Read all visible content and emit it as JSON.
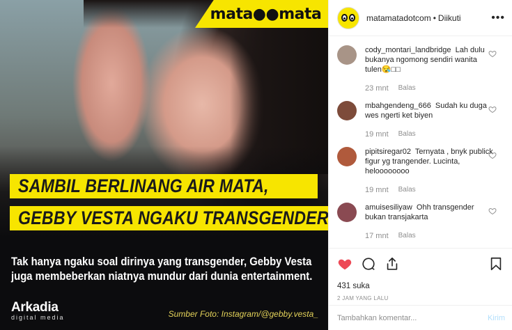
{
  "post_image": {
    "brand": "mata●●mata",
    "headline_line1": "SAMBIL BERLINANG AIR MATA,",
    "headline_line2": "GEBBY VESTA NGAKU TRANSGENDER",
    "subcaption": "Tak hanya ngaku soal dirinya yang transgender, Gebby Vesta juga membeberkan niatnya mundur dari dunia entertainment.",
    "publisher_logo": "Arkadia",
    "publisher_tagline": "digital media",
    "photo_credit": "Sumber Foto: Instagram/@gebby.vesta_"
  },
  "header": {
    "username": "matamatadotcom",
    "separator": "•",
    "follow_status": "Diikuti",
    "more_icon": "more-horizontal-icon"
  },
  "comments": [
    {
      "username": "cody_montari_landbridge",
      "text": "Lah dulu bukanya ngomong sendiri wanita tulen😪□□",
      "time": "23 mnt",
      "reply_label": "Balas",
      "avatar_color": "#a89487"
    },
    {
      "username": "mbahgendeng_666",
      "text": "Sudah ku duga wes ngerti ket biyen",
      "time": "19 mnt",
      "reply_label": "Balas",
      "avatar_color": "#7d4b3a"
    },
    {
      "username": "pipitsiregar02",
      "text": "Ternyata , bnyk publick figur yg trangender. Lucinta, heloooooooo",
      "time": "19 mnt",
      "reply_label": "Balas",
      "avatar_color": "#b05a3c"
    },
    {
      "username": "amuisesiliyaw",
      "text": "Ohh transgender bukan transjakarta",
      "time": "17 mnt",
      "reply_label": "Balas",
      "avatar_color": "#8a4a52"
    }
  ],
  "actions": {
    "like_icon": "heart-filled-icon",
    "comment_icon": "comment-bubble-icon",
    "share_icon": "share-icon",
    "save_icon": "bookmark-icon",
    "like_color": "#ed4956"
  },
  "likes_text": "431 suka",
  "time_ago": "2 JAM YANG LALU",
  "add_comment": {
    "placeholder": "Tambahkan komentar...",
    "post_label": "Kirim"
  }
}
